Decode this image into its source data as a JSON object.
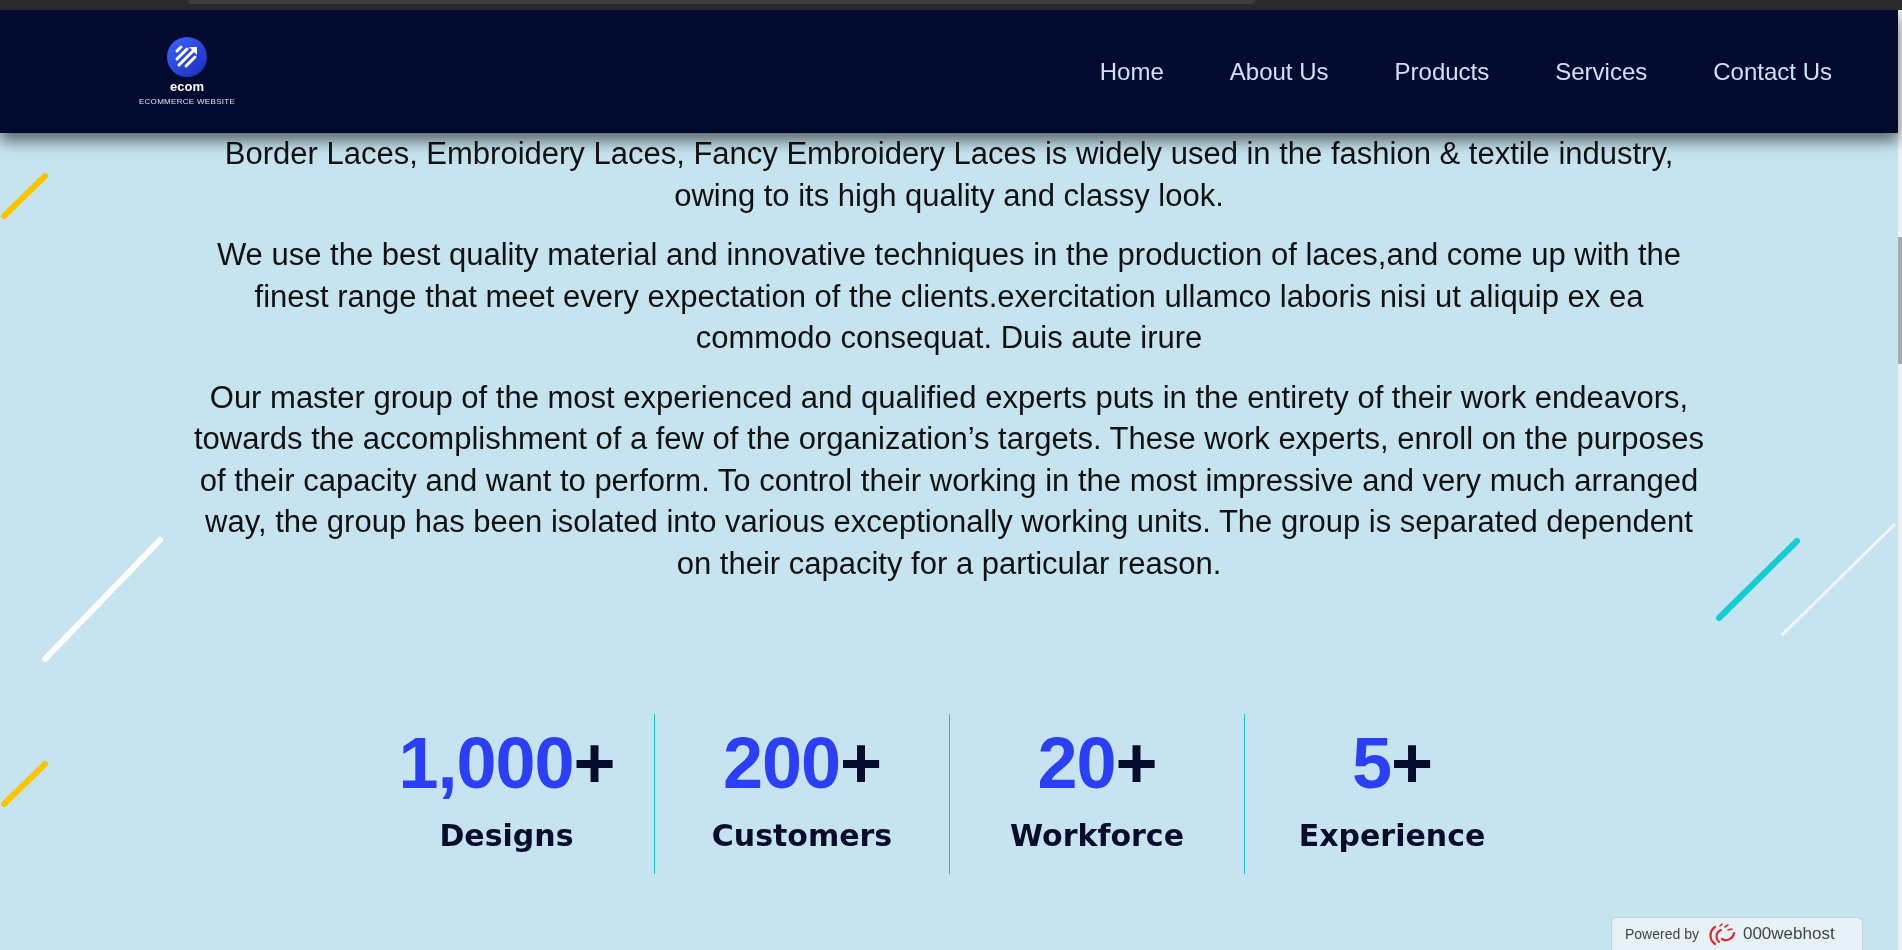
{
  "header": {
    "logo": {
      "name": "ecom",
      "tagline": "ECOMMERCE WEBSITE"
    },
    "nav": [
      "Home",
      "About Us",
      "Products",
      "Services",
      "Contact Us"
    ]
  },
  "about": {
    "paragraphs": [
      "Border Laces, Embroidery Laces, Fancy Embroidery Laces is widely used in the fashion & textile industry, owing to its high quality and classy look.",
      "We use the best quality material and innovative techniques in the production of laces,and come up with the finest range that meet every expectation of the clients.exercitation ullamco laboris nisi ut aliquip ex ea commodo consequat. Duis aute irure",
      "Our master group of the most experienced and qualified experts puts in the entirety of their work endeavors, towards the accomplishment of a few of the organization’s targets. These work experts, enroll on the purposes of their capacity and want to perform. To control their working in the most impressive and very much arranged way, the group has been isolated into various exceptionally working units. The group is separated dependent on their capacity for a particular reason."
    ]
  },
  "stats": [
    {
      "value": "1,000",
      "suffix": "+",
      "label": "Designs"
    },
    {
      "value": "200",
      "suffix": "+",
      "label": "Customers"
    },
    {
      "value": "20",
      "suffix": "+",
      "label": "Workforce"
    },
    {
      "value": "5",
      "suffix": "+",
      "label": "Experience"
    }
  ],
  "hosting_badge": {
    "prefix": "Powered by",
    "brand": "000webhost"
  }
}
